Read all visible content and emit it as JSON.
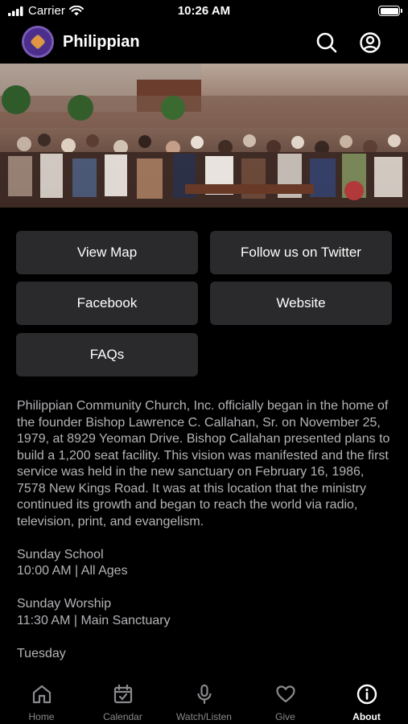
{
  "status_bar": {
    "carrier": "Carrier",
    "time": "10:26 AM"
  },
  "header": {
    "title": "Philippian"
  },
  "buttons": {
    "view_map": "View Map",
    "twitter": "Follow us on Twitter",
    "facebook": "Facebook",
    "website": "Website",
    "faqs": "FAQs"
  },
  "about": {
    "intro": "Philippian Community Church, Inc. officially began in the home of the founder Bishop Lawrence C. Callahan, Sr. on November 25, 1979, at 8929 Yeoman Drive. Bishop Callahan presented plans to build a 1,200 seat facility. This vision was manifested and the first service was held in the new sanctuary on February 16, 1986, 7578 New Kings Road. It was at this location that the ministry continued its growth and began to reach the world via radio, television, print, and evangelism.",
    "sunday_school_title": "Sunday School",
    "sunday_school_time": "10:00 AM | All Ages",
    "sunday_worship_title": "Sunday Worship",
    "sunday_worship_time": "11:30 AM | Main Sanctuary",
    "tuesday_title": "Tuesday"
  },
  "tabs": [
    {
      "label": "Home",
      "icon": "home-icon"
    },
    {
      "label": "Calendar",
      "icon": "calendar-icon"
    },
    {
      "label": "Watch/Listen",
      "icon": "microphone-icon"
    },
    {
      "label": "Give",
      "icon": "heart-icon"
    },
    {
      "label": "About",
      "icon": "info-icon",
      "active": true
    }
  ]
}
